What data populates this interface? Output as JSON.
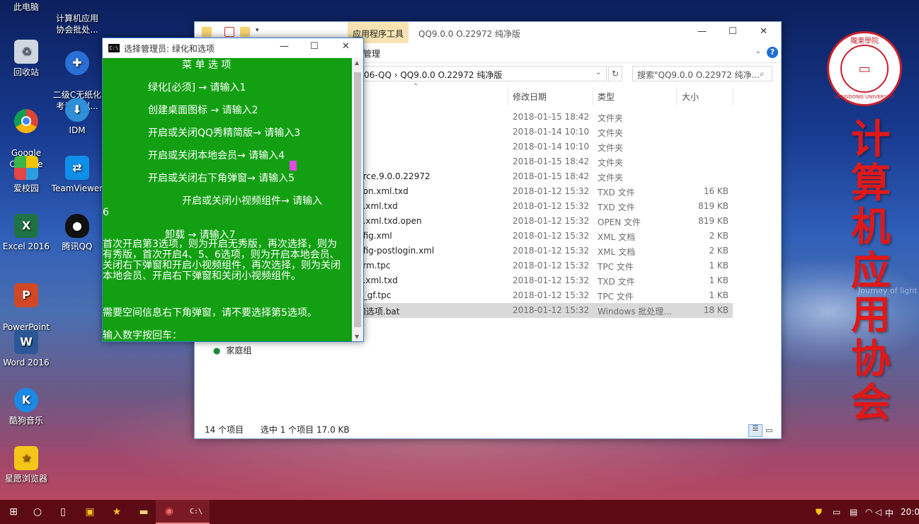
{
  "desktop": {
    "icons": [
      {
        "label": "此电脑"
      },
      {
        "label": "计算机应用\n协会批处..."
      },
      {
        "label": "回收站"
      },
      {
        "label": "二级C无纸化\n考试模拟..."
      },
      {
        "label": "Google\nChrome"
      },
      {
        "label": "IDM"
      },
      {
        "label": "爱校园"
      },
      {
        "label": "TeamViewer"
      },
      {
        "label": "Excel 2016"
      },
      {
        "label": "腾讯QQ"
      },
      {
        "label": "PowerPoint\n2016"
      },
      {
        "label": "Word 2016"
      },
      {
        "label": "酷狗音乐"
      },
      {
        "label": "星愿浏览器"
      }
    ]
  },
  "explorer": {
    "title": "QQ9.0.0 O.22972 纯净版",
    "context_tab": "应用程序工具",
    "ribbon_tab": "管理",
    "address": "06-QQ  ›  QQ9.0.0 O.22972 纯净版",
    "search_placeholder": "搜索\"QQ9.0.0 O.22972 纯净...",
    "columns": {
      "date": "修改日期",
      "type": "类型",
      "size": "大小"
    },
    "rows": [
      {
        "name": "",
        "date": "2018-01-15 18:42",
        "type": "文件夹",
        "size": ""
      },
      {
        "name": "",
        "date": "2018-01-14 10:10",
        "type": "文件夹",
        "size": ""
      },
      {
        "name": "",
        "date": "2018-01-14 10:10",
        "type": "文件夹",
        "size": ""
      },
      {
        "name": "n",
        "date": "2018-01-15 18:42",
        "type": "文件夹",
        "size": ""
      },
      {
        "name": "urce.9.0.0.22972",
        "date": "2018-01-15 18:42",
        "type": "文件夹",
        "size": ""
      },
      {
        "name": "non.xml.txd",
        "date": "2018-01-12 15:32",
        "type": "TXD 文件",
        "size": "16 KB"
      },
      {
        "name": "g.xml.txd",
        "date": "2018-01-12 15:32",
        "type": "TXD 文件",
        "size": "819 KB"
      },
      {
        "name": "g.xml.txd.open",
        "date": "2018-01-12 15:32",
        "type": "OPEN 文件",
        "size": "819 KB"
      },
      {
        "name": "nfig.xml",
        "date": "2018-01-12 15:32",
        "type": "XML 文档",
        "size": "2 KB"
      },
      {
        "name": "nfig-postlogin.xml",
        "date": "2018-01-12 15:32",
        "type": "XML 文档",
        "size": "2 KB"
      },
      {
        "name": "orm.tpc",
        "date": "2018-01-12 15:32",
        "type": "TPC 文件",
        "size": "1 KB"
      },
      {
        "name": "p.xml.txd",
        "date": "2018-01-12 15:32",
        "type": "TXD 文件",
        "size": "1 KB"
      },
      {
        "name": "p_gf.tpc",
        "date": "2018-01-12 15:32",
        "type": "TPC 文件",
        "size": "1 KB"
      },
      {
        "name": "和选项.bat",
        "date": "2018-01-12 15:32",
        "type": "Windows 批处理...",
        "size": "18 KB"
      }
    ],
    "nav_home": "家庭组",
    "status_count": "14 个项目",
    "status_selected": "选中 1 个项目  17.0 KB"
  },
  "console": {
    "title": "选择管理员:  绿化和选项",
    "menu_title": "菜 单 选 项",
    "opt1": "绿化[必须] → 请输入1",
    "opt2": "创建桌面图标 → 请输入2",
    "opt3": "开启或关闭QQ秀精简版→ 请输入3",
    "opt4": "开启或关闭本地会员→ 请输入4",
    "opt5": "开启或关闭右下角弹窗→ 请输入5",
    "opt6": "开启或关闭小视频组件→ 请输入",
    "opt6_num": "6",
    "opt7": "卸载 → 请输入7",
    "note1": "首次开启第3选项，则为开启无秀版，再次选择，则为有秀版，首次开启4、5、6选项，则为开启本地会员、关闭右下弹窗和开启小视频组件，再次选择，则为关闭本地会员、开启右下弹窗和关闭小视频组件。",
    "note2": "需要空间信息右下角弹窗，请不要选择第5选项。",
    "prompt": "输入数字按回车："
  },
  "branding": {
    "logo_top": "隴東學院",
    "logo_center": "计算机应用协会",
    "logo_bottom": "LONGDONG UNIVERSITY",
    "calligraphy": [
      "计",
      "算",
      "机",
      "应",
      "用",
      "协",
      "会"
    ],
    "faint_text": "Journey of light"
  },
  "taskbar": {
    "clock": "20:0",
    "ime": "中"
  }
}
